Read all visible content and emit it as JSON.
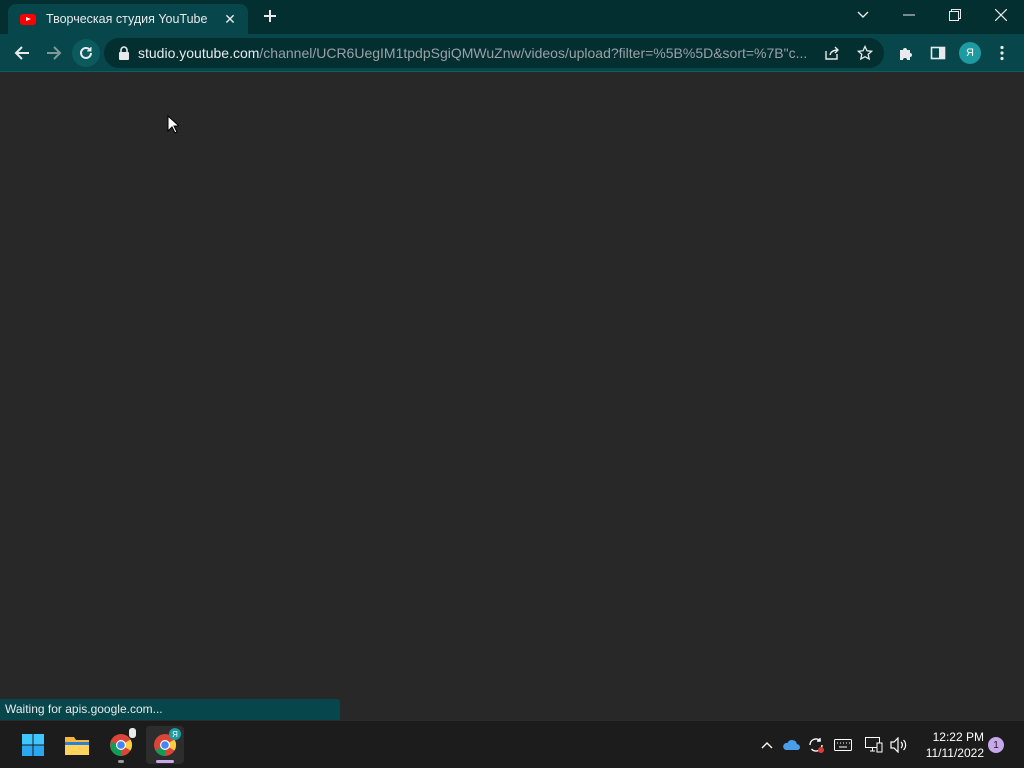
{
  "browser": {
    "tab": {
      "title": "Творческая студия YouTube",
      "favicon": "youtube-icon"
    },
    "new_tab_icon": "plus-icon",
    "window_controls": [
      "chevron-down-icon",
      "minimize-icon",
      "restore-icon",
      "close-icon"
    ],
    "address": {
      "host": "studio.youtube.com",
      "path": "/channel/UCR6UegIM1tpdpSgiQMWuZnw/videos/upload?filter=%5B%5D&sort=%7B\"c..."
    },
    "profile_initial": "Я",
    "status_text": "Waiting for apis.google.com..."
  },
  "taskbar": {
    "apps": [
      "windows-start-icon",
      "file-explorer-icon",
      "chrome-icon",
      "chrome-profile-icon"
    ],
    "profile_badge": "Я",
    "clock": {
      "time": "12:22 PM",
      "date": "11/11/2022"
    },
    "notification_count": "1"
  },
  "colors": {
    "frame": "#042f31",
    "toolbar": "#07464a",
    "page_bg": "#282828",
    "taskbar": "#1c1c1c"
  }
}
